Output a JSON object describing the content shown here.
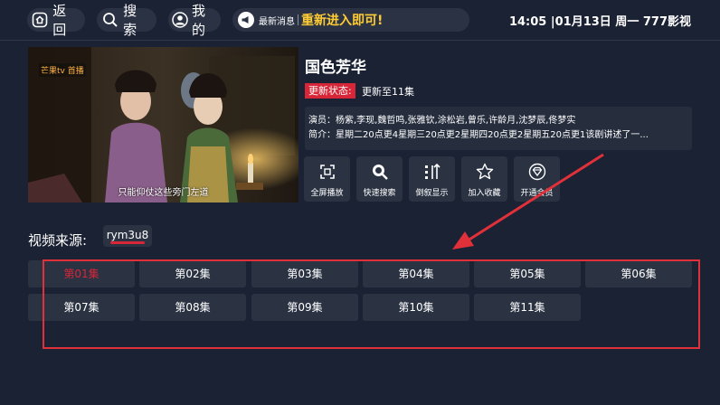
{
  "topbar": {
    "back_label": "返回",
    "search_label": "搜索",
    "mine_label": "我的",
    "news_label": "最新消息",
    "news_text": "重新进入即可!",
    "clock": "14:05 |01月13日 周一  777影视"
  },
  "poster": {
    "logo": "芒果tv 首播",
    "subtitle": "只能仰仗这些旁门左道"
  },
  "detail": {
    "title": "国色芳华",
    "status_badge": "更新状态:",
    "status_text": "更新至11集",
    "cast": "演员：杨紫,李现,魏哲鸣,张雅钦,涂松岩,曾乐,许龄月,沈梦辰,佟梦实",
    "summary": "简介：星期二20点更4星期三20点更2星期四20点更2星期五20点更1该剧讲述了一..."
  },
  "actions": [
    {
      "label": "全屏播放",
      "icon": "fullscreen-icon"
    },
    {
      "label": "快速搜索",
      "icon": "search-icon"
    },
    {
      "label": "倒叙显示",
      "icon": "sort-icon"
    },
    {
      "label": "加入收藏",
      "icon": "star-icon"
    },
    {
      "label": "开通会员",
      "icon": "vip-diamond-icon"
    }
  ],
  "source": {
    "label": "视频来源:",
    "selected": "rym3u8"
  },
  "episodes": [
    {
      "label": "第01集",
      "active": true
    },
    {
      "label": "第02集"
    },
    {
      "label": "第03集"
    },
    {
      "label": "第04集"
    },
    {
      "label": "第05集"
    },
    {
      "label": "第06集"
    },
    {
      "label": "第07集"
    },
    {
      "label": "第08集"
    },
    {
      "label": "第09集"
    },
    {
      "label": "第10集"
    },
    {
      "label": "第11集"
    }
  ],
  "colors": {
    "background": "#1b2233",
    "accent_red": "#d72638",
    "news_yellow": "#ffcc33",
    "card": "#2b3343"
  }
}
